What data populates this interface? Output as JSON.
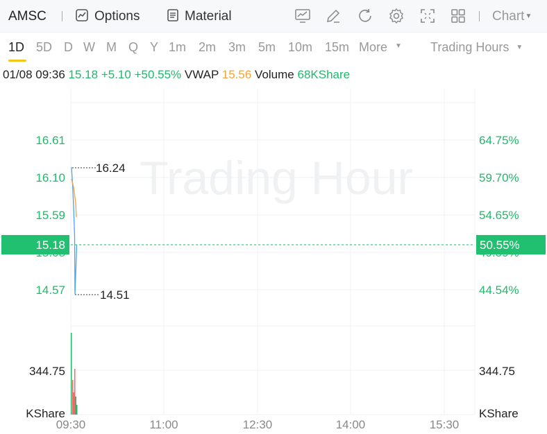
{
  "topbar": {
    "ticker": "AMSC",
    "options_label": "Options",
    "material_label": "Material",
    "chart_label": "Chart"
  },
  "periods": [
    "1D",
    "5D",
    "D",
    "W",
    "M",
    "Q",
    "Y",
    "1m",
    "2m",
    "3m",
    "5m",
    "10m",
    "15m",
    "More"
  ],
  "active_period": "1D",
  "trading_hours_label": "Trading Hours",
  "info": {
    "datetime": "01/08 09:36",
    "price": "15.18",
    "change": "+5.10",
    "change_pct": "+50.55%",
    "vwap_label": "VWAP",
    "vwap": "15.56",
    "volume_label": "Volume",
    "volume": "68KShare"
  },
  "chart": {
    "watermark": "Trading Hour",
    "y_left": [
      "16.61",
      "16.10",
      "15.59",
      "15.08",
      "14.57"
    ],
    "y_right": [
      "64.75%",
      "59.70%",
      "54.65%",
      "49.59%",
      "44.54%"
    ],
    "current_price": "15.18",
    "current_pct": "50.55%",
    "high_label": "16.24",
    "low_label": "14.51",
    "vol_left": "344.75",
    "vol_right": "344.75",
    "vol_unit_left": "KShare",
    "vol_unit_right": "KShare",
    "x_ticks": [
      "09:30",
      "11:00",
      "12:30",
      "14:00",
      "15:30"
    ],
    "colors": {
      "up": "#21b86a",
      "vwap": "#f2a33a",
      "price_line": "#4aa3f0",
      "down": "#f06b6b",
      "grid": "#eef0f3"
    }
  },
  "chart_data": {
    "type": "line",
    "series": [
      {
        "values": [
          16.24,
          16.02,
          15.7,
          15.3,
          14.51,
          15.18
        ]
      }
    ],
    "high": 16.24,
    "low": 14.51,
    "ylim": [
      14.57,
      16.61
    ]
  }
}
